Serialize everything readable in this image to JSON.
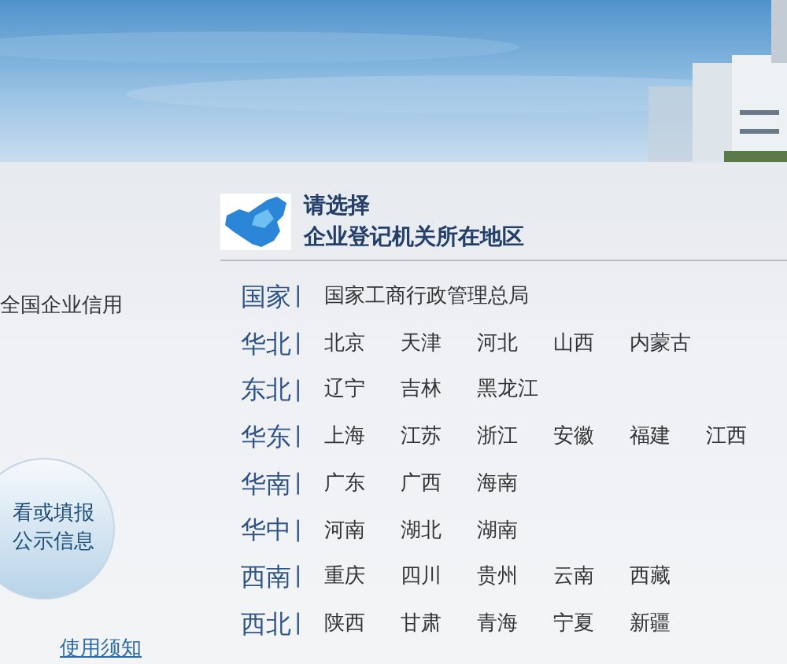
{
  "left_panel": {
    "intro": "全国企业信用",
    "circle_button": {
      "lines": [
        "看或填报",
        "公示信息"
      ]
    },
    "link": "使用须知"
  },
  "region_select": {
    "title": "请选择",
    "subtitle": "企业登记机关所在地区",
    "groups": [
      {
        "label": "国家",
        "separator": "|",
        "items": [
          "国家工商行政管理总局"
        ]
      },
      {
        "label": "华北",
        "separator": "|",
        "items": [
          "北京",
          "天津",
          "河北",
          "山西",
          "内蒙古"
        ]
      },
      {
        "label": "东北",
        "separator": "|",
        "items": [
          "辽宁",
          "吉林",
          "黑龙江"
        ]
      },
      {
        "label": "华东",
        "separator": "|",
        "items": [
          "上海",
          "江苏",
          "浙江",
          "安徽",
          "福建",
          "江西"
        ]
      },
      {
        "label": "华南",
        "separator": "|",
        "items": [
          "广东",
          "广西",
          "海南"
        ]
      },
      {
        "label": "华中",
        "separator": "|",
        "items": [
          "河南",
          "湖北",
          "湖南"
        ]
      },
      {
        "label": "西南",
        "separator": "|",
        "items": [
          "重庆",
          "四川",
          "贵州",
          "云南",
          "西藏"
        ]
      },
      {
        "label": "西北",
        "separator": "|",
        "items": [
          "陕西",
          "甘肃",
          "青海",
          "宁夏",
          "新疆"
        ]
      }
    ]
  }
}
